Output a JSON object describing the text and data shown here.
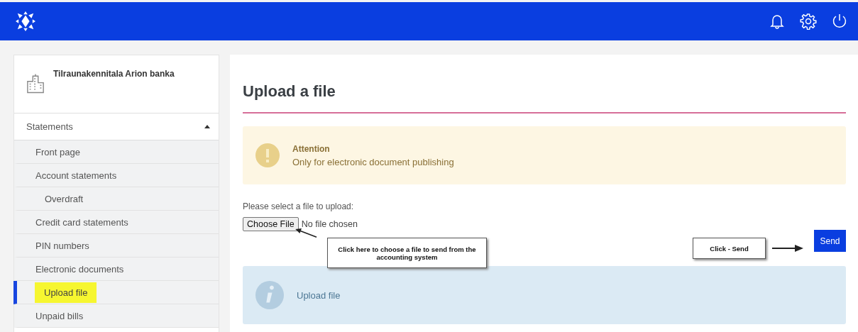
{
  "sidebar": {
    "company": "Tilraunakennitala Arion banka",
    "menu": {
      "label": "Statements",
      "expanded": true,
      "children": [
        {
          "label": "Front page",
          "selected": false,
          "highlighted": false
        },
        {
          "label": "Account statements",
          "selected": false,
          "highlighted": false,
          "children": [
            {
              "label": "Overdraft",
              "selected": false,
              "highlighted": false
            }
          ]
        },
        {
          "label": "Credit card statements",
          "selected": false,
          "highlighted": false
        },
        {
          "label": "PIN numbers",
          "selected": false,
          "highlighted": false
        },
        {
          "label": "Electronic documents",
          "selected": false,
          "highlighted": false,
          "children": [
            {
              "label": "Upload file",
              "selected": true,
              "highlighted": true
            }
          ]
        },
        {
          "label": "Unpaid bills",
          "selected": false,
          "highlighted": false
        }
      ]
    }
  },
  "main": {
    "title": "Upload a file",
    "alert": {
      "kind": "warning",
      "title": "Attention",
      "text": "Only for electronic document publishing"
    },
    "file_label": "Please select a file to upload:",
    "file_button": "Choose File",
    "file_status": "No file chosen",
    "send_button": "Send",
    "info": {
      "kind": "info",
      "text": "Upload file"
    }
  },
  "annotations": [
    {
      "kind": "file",
      "text": "Click here to choose a file to send from the accounting system"
    },
    {
      "kind": "send",
      "text": "Click - Send"
    }
  ]
}
